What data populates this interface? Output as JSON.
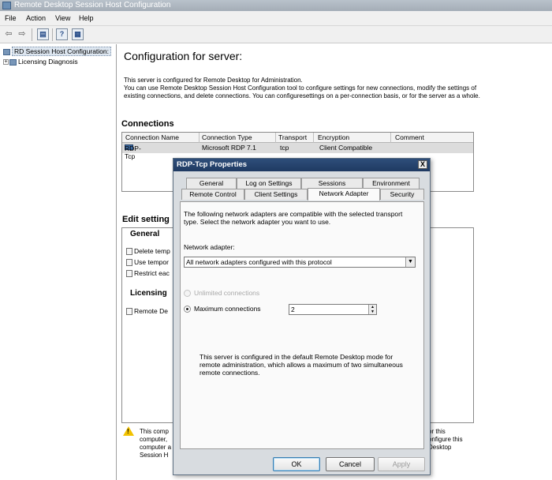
{
  "window": {
    "title": "Remote Desktop Session Host Configuration",
    "menu": [
      "File",
      "Action",
      "View",
      "Help"
    ]
  },
  "toolbar": {
    "back_icon": "back-arrow-icon",
    "forward_icon": "forward-arrow-icon"
  },
  "tree": {
    "root": "RD Session Host Configuration:",
    "child": "Licensing Diagnosis"
  },
  "main": {
    "title": "Configuration for server:",
    "description": [
      "This server is configured for Remote Desktop for Administration.",
      "You can use Remote Desktop Session Host Configuration tool to configure settings for new connections, modify the settings of",
      "existing connections, and delete connections. You can configuresettings on a per-connection basis, or for the server as a whole."
    ],
    "connections_heading": "Connections",
    "columns": [
      "Connection Name",
      "Connection Type",
      "Transport",
      "Encryption",
      "Comment"
    ],
    "rows": [
      [
        "RDP-Tcp",
        "Microsoft RDP 7.1",
        "tcp",
        "Client Compatible",
        ""
      ]
    ],
    "edit_heading": "Edit setting",
    "general_heading": "General",
    "general_items": [
      "Delete temp",
      "Use tempor",
      "Restrict eac"
    ],
    "licensing_heading": "Licensing",
    "licensing_items": [
      "Remote De"
    ],
    "warning_left": [
      "This comp",
      "computer,",
      "computer a",
      "Session H"
    ],
    "warning_right": [
      "or this",
      "onfigure this",
      "Desktop"
    ]
  },
  "dialog": {
    "title": "RDP-Tcp Properties",
    "close": "X",
    "tabs_row1": [
      "General",
      "Log on Settings",
      "Sessions",
      "Environment"
    ],
    "tabs_row2": [
      "Remote Control",
      "Client Settings",
      "Network Adapter",
      "Security"
    ],
    "active_tab": "Network Adapter",
    "intro": [
      "The following network adapters are compatible with the selected transport",
      "type. Select the network adapter you want to use."
    ],
    "adapter_label": "Network adapter:",
    "adapter_value": "All network adapters configured with this protocol",
    "unlimited_label": "Unlimited connections",
    "maximum_label": "Maximum connections",
    "maximum_value": "2",
    "note": [
      "This server is configured in the default Remote Desktop mode for",
      "remote administration, which allows a maximum of two simultaneous",
      "remote connections."
    ],
    "ok": "OK",
    "cancel": "Cancel",
    "apply": "Apply"
  }
}
